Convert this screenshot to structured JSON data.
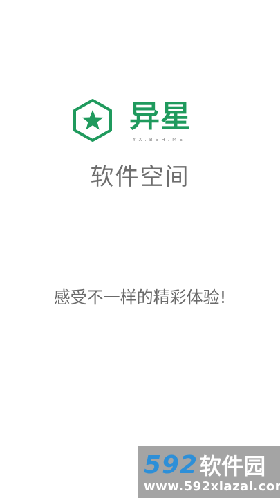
{
  "splash": {
    "brand_name": "异星",
    "brand_domain": "YX.BSH.ME",
    "subtitle": "软件空间",
    "tagline": "感受不一样的精彩体验!"
  },
  "watermark": {
    "number": "592",
    "text": "软件园",
    "url": "www.592xiazai.com"
  },
  "colors": {
    "brand_green": "#1f9a5d",
    "text_gray": "#6e6e6e",
    "watermark_blue": "#2d8fd8",
    "background": "#ffffff"
  },
  "icons": {
    "logo": "hexagon-star-icon"
  }
}
